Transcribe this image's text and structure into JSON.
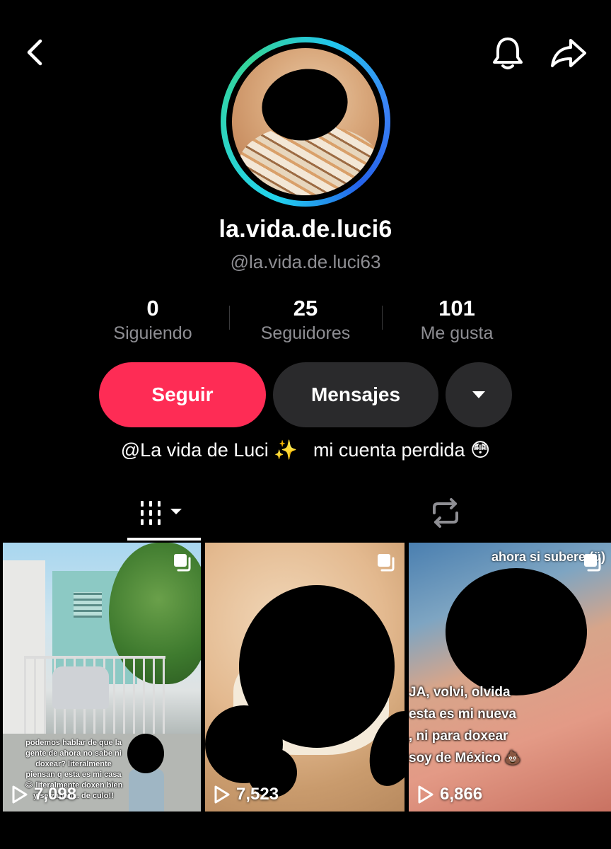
{
  "profile": {
    "display_name": "la.vida.de.luci6",
    "handle": "@la.vida.de.luci63",
    "bio": "@La vida de Luci ✨",
    "bio_secondary": "mi cuenta perdida 😳"
  },
  "stats": [
    {
      "value": "0",
      "label": "Siguiendo"
    },
    {
      "value": "25",
      "label": "Seguidores"
    },
    {
      "value": "101",
      "label": "Me gusta"
    }
  ],
  "actions": {
    "follow_label": "Seguir",
    "message_label": "Mensajes"
  },
  "icons": {
    "back": "back-icon",
    "bell": "bell-icon",
    "share": "share-icon",
    "dropdown": "caret-down-icon",
    "videos_tab": "grid-icon",
    "reposts_tab": "repost-icon",
    "play": "play-icon",
    "multi": "multi-image-icon"
  },
  "colors": {
    "follow_button": "#fe2c55",
    "secondary_button": "#2a2a2c",
    "muted_text": "#8e8e93"
  },
  "videos": [
    {
      "views": "7,098",
      "caption": "podemos hablar de que la gente de ahora no sabe ni doxear? literalmente piensan q esta es mi casa 😂 literalmente doxen bien y se zapan... de culo!!"
    },
    {
      "views": "7,523"
    },
    {
      "views": "6,866",
      "overlay_top": "ahora si subere (ü)",
      "caption_lines": [
        "JA, volvi, olvida",
        "esta es mi nueva",
        ", ni para doxear",
        "soy de México 💩"
      ]
    }
  ]
}
